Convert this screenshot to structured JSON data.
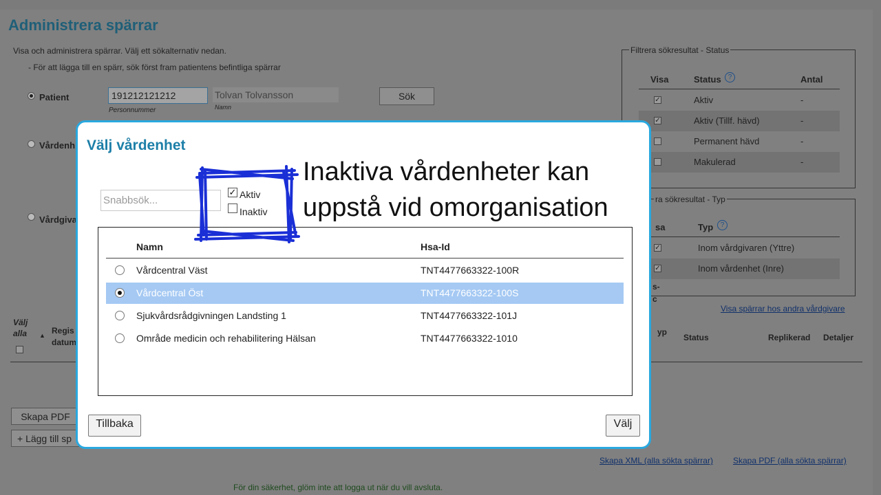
{
  "page": {
    "title": "Administrera spärrar",
    "intro": "Visa och administrera spärrar. Välj ett sökalternativ nedan.",
    "intro_sub": "- För att lägga till en spärr, sök först fram patientens befintliga spärrar",
    "search": {
      "patient_label": "Patient",
      "personnummer_value": "191212121212",
      "personnummer_hint": "Personnummer",
      "name_value": "Tolvan Tolvansson",
      "name_hint": "Namn",
      "search_button": "Sök",
      "vardenhet_label": "Vårdenh",
      "vardgivare_label": "Vårdgiva"
    },
    "table_head": {
      "valj_alla": "Välj alla",
      "regis": "Regis",
      "datum": "datum",
      "typ": "yp",
      "status": "Status",
      "replikerad": "Replikerad",
      "detaljer": "Detaljer"
    },
    "buttons": {
      "skapa_pdf": "Skapa PDF",
      "lagg_till": "+ Lägg till sp"
    },
    "status_filter": {
      "legend": "Filtrera sökresultat - Status",
      "headers": [
        "Visa",
        "Status",
        "Antal"
      ],
      "rows": [
        {
          "checked": true,
          "status": "Aktiv",
          "antal": "-"
        },
        {
          "checked": true,
          "status": "Aktiv (Tillf. hävd)",
          "antal": "-"
        },
        {
          "checked": false,
          "status": "Permanent hävd",
          "antal": "-"
        },
        {
          "checked": false,
          "status": "Makulerad",
          "antal": "-"
        }
      ]
    },
    "type_filter": {
      "legend": "ra sökresultat - Typ",
      "headers": [
        "sa",
        "Typ"
      ],
      "rows": [
        {
          "checked": true,
          "typ": "Inom vårdgivaren (Yttre)"
        },
        {
          "checked": true,
          "typ": "Inom vårdenhet (Inre)"
        }
      ],
      "fragment_1": "s-",
      "fragment_2": "c"
    },
    "links": {
      "visa_andra": "Visa spärrar hos andra vårdgivare",
      "skapa_xml": "Skapa XML (alla sökta spärrar)",
      "skapa_pdf_all": "Skapa PDF (alla sökta spärrar)"
    },
    "footer": "För din säkerhet, glöm inte att logga ut när du vill avsluta."
  },
  "modal": {
    "title": "Välj vårdenhet",
    "quicksearch_placeholder": "Snabbsök...",
    "filter_aktiv": "Aktiv",
    "filter_aktiv_checked": true,
    "filter_inaktiv": "Inaktiv",
    "filter_inaktiv_checked": false,
    "columns": [
      "Namn",
      "Hsa-Id"
    ],
    "rows": [
      {
        "name": "Vårdcentral Väst",
        "hsa": "TNT4477663322-100R",
        "selected": false
      },
      {
        "name": "Vårdcentral Öst",
        "hsa": "TNT4477663322-100S",
        "selected": true
      },
      {
        "name": "Sjukvårdsrådgivningen Landsting 1",
        "hsa": "TNT4477663322-101J",
        "selected": false
      },
      {
        "name": "Område medicin och rehabilitering Hälsan",
        "hsa": "TNT4477663322-1010",
        "selected": false
      }
    ],
    "back_button": "Tillbaka",
    "choose_button": "Välj"
  },
  "annotation": {
    "line1": "Inaktiva vårdenheter kan",
    "line2": "uppstå vid omorganisation",
    "highlight_color": "#1a2fd6"
  }
}
